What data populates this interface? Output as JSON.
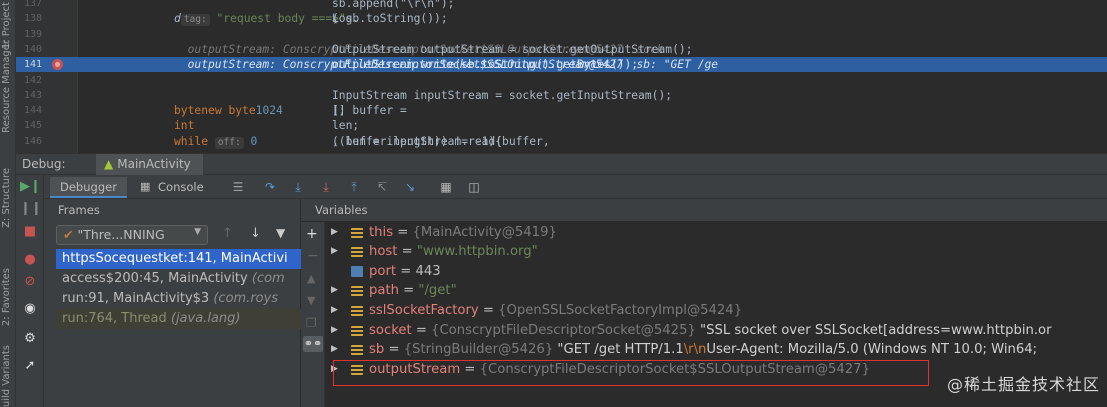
{
  "left_stripe": {
    "labels": [
      "1: Project",
      "Resource Manager",
      "Z: Structure",
      "2: Favorites",
      "Build Variants"
    ]
  },
  "editor": {
    "lines": [
      {
        "num": "137",
        "segments": [
          {
            "t": "sb.append(\"\\r\\n\");",
            "c": "code"
          }
        ]
      },
      {
        "num": "138",
        "segments": [
          {
            "t": "Log.",
            "c": "code"
          },
          {
            "t": "d",
            "c": "fn"
          },
          {
            "t": "(",
            "c": "code"
          },
          {
            "t": "tag:",
            "c": "param"
          },
          {
            "t": " \"request body ===>\"",
            "c": "str"
          },
          {
            "t": ", sb.toString());",
            "c": "code"
          }
        ]
      },
      {
        "num": "139",
        "segments": []
      },
      {
        "num": "140",
        "segments": [
          {
            "t": "OutputStream outputStream = socket.getOutputStream();",
            "c": "code"
          },
          {
            "t": "  outputStream: ConscryptFileDescriptorSocket$SSLOutputStream@5427  sock",
            "c": "hint"
          }
        ]
      },
      {
        "num": "141",
        "segments": [
          {
            "t": "outputStream.write(sb.toString().getBytes());",
            "c": "code"
          },
          {
            "t": "  outputStream: ConscryptFileDescriptorSocket$SSLOutputStream@5427  sb: \"GET /ge",
            "c": "inl"
          }
        ]
      },
      {
        "num": "142",
        "segments": []
      },
      {
        "num": "143",
        "segments": [
          {
            "t": "InputStream inputStream = socket.getInputStream();",
            "c": "code"
          }
        ]
      },
      {
        "num": "144",
        "segments": [
          {
            "t": "byte",
            "c": "kw"
          },
          {
            "t": "[] buffer = ",
            "c": "code"
          },
          {
            "t": "new ",
            "c": "kw"
          },
          {
            "t": "byte",
            "c": "kw"
          },
          {
            "t": "[",
            "c": "code"
          },
          {
            "t": "1024",
            "c": "num"
          },
          {
            "t": "];",
            "c": "code"
          }
        ]
      },
      {
        "num": "145",
        "segments": [
          {
            "t": "int ",
            "c": "kw"
          },
          {
            "t": "len;",
            "c": "code"
          }
        ]
      },
      {
        "num": "146",
        "segments": [
          {
            "t": "while ",
            "c": "kw"
          },
          {
            "t": "((len = inputStream.read(buffer, ",
            "c": "code"
          },
          {
            "t": "off:",
            "c": "param"
          },
          {
            "t": " 0",
            "c": "num"
          },
          {
            "t": ", buffer.length)) != -1){",
            "c": "code"
          }
        ]
      }
    ]
  },
  "debug": {
    "title": "Debug:",
    "tab": "MainActivity",
    "tabs": {
      "debugger": "Debugger",
      "console": "Console"
    },
    "frames_header": "Frames",
    "thread": "\"Thre...NNING",
    "frames": [
      {
        "name": "httpsSocequestket:141, MainActivi",
        "loc": ""
      },
      {
        "name": "access$200:45, MainActivity ",
        "loc": "(com"
      },
      {
        "name": "run:91, MainActivity$3 ",
        "loc": "(com.roys"
      },
      {
        "name": "run:764, Thread ",
        "loc": "(java.lang)"
      }
    ],
    "variables_header": "Variables",
    "variables": [
      {
        "name": "this",
        "icon": "object-icon",
        "expand": true,
        "parts": [
          {
            "t": " = ",
            "c": "veq"
          },
          {
            "t": "{MainActivity@5419}",
            "c": "vref"
          }
        ]
      },
      {
        "name": "host",
        "icon": "object-icon",
        "expand": true,
        "parts": [
          {
            "t": " = ",
            "c": "veq"
          },
          {
            "t": "\"www.httpbin.org\"",
            "c": "vstr"
          }
        ]
      },
      {
        "name": "port",
        "icon": "primitive-icon",
        "expand": false,
        "parts": [
          {
            "t": " = ",
            "c": "veq"
          },
          {
            "t": "443",
            "c": "vnum"
          }
        ]
      },
      {
        "name": "path",
        "icon": "object-icon",
        "expand": true,
        "parts": [
          {
            "t": " = ",
            "c": "veq"
          },
          {
            "t": "\"/get\"",
            "c": "vstr"
          }
        ]
      },
      {
        "name": "sslSocketFactory",
        "icon": "object-icon",
        "expand": true,
        "parts": [
          {
            "t": " = ",
            "c": "veq"
          },
          {
            "t": "{OpenSSLSocketFactoryImpl@5424}",
            "c": "vref"
          }
        ]
      },
      {
        "name": "socket",
        "icon": "object-icon",
        "expand": true,
        "parts": [
          {
            "t": " = ",
            "c": "veq"
          },
          {
            "t": "{ConscryptFileDescriptorSocket@5425} ",
            "c": "vref"
          },
          {
            "t": "\"SSL socket over SSLSocket[address=www.httpbin.or",
            "c": "vplain"
          }
        ]
      },
      {
        "name": "sb",
        "icon": "object-icon",
        "expand": true,
        "parts": [
          {
            "t": " = ",
            "c": "veq"
          },
          {
            "t": "{StringBuilder@5426} ",
            "c": "vref"
          },
          {
            "t": "\"GET /get HTTP/1.1",
            "c": "vplain"
          },
          {
            "t": "\\r\\n",
            "c": "vesc"
          },
          {
            "t": "User-Agent: Mozilla/5.0 (Windows NT 10.0; Win64;",
            "c": "vplain"
          }
        ]
      },
      {
        "name": "outputStream",
        "icon": "object-icon",
        "expand": true,
        "parts": [
          {
            "t": " = ",
            "c": "veq"
          },
          {
            "t": "{ConscryptFileDescriptorSocket$SSLOutputStream@5427}",
            "c": "vref"
          }
        ]
      }
    ]
  },
  "watermark": "@稀土掘金技术社区"
}
